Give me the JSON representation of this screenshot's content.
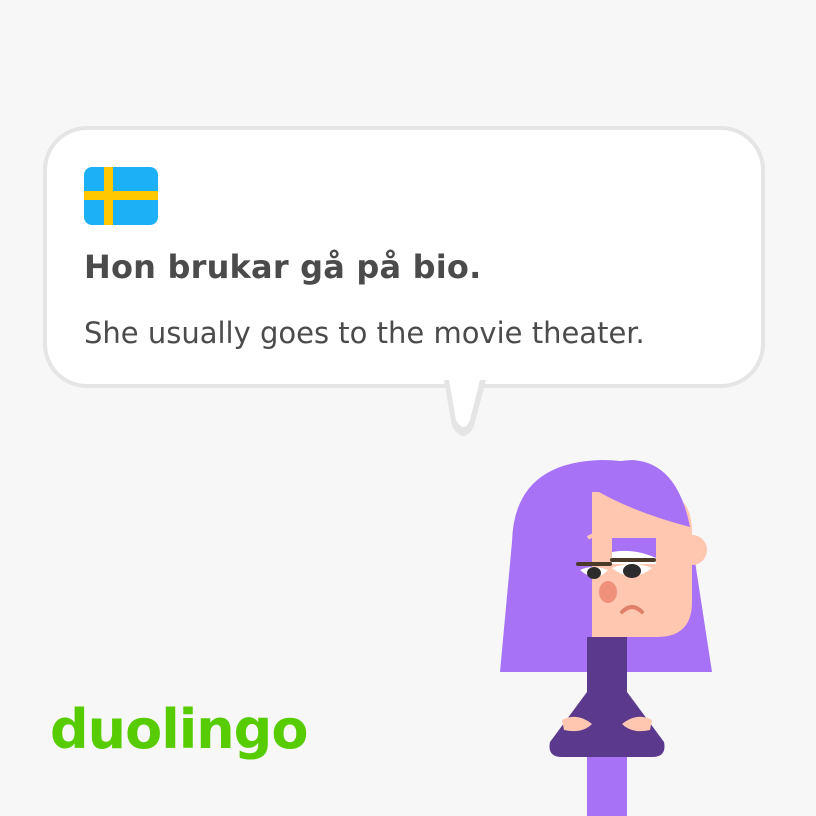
{
  "card": {
    "flag_icon": "sweden-flag-icon",
    "phrase": "Hon brukar gå på bio.",
    "translation": "She usually goes to the movie theater."
  },
  "brand": {
    "logo_text": "duolingo",
    "logo_color": "#58cc02"
  },
  "character": {
    "name_icon": "lily-character-illustration",
    "hair_color": "#a772f5",
    "skin_color": "#ffc6b0",
    "shirt_color": "#5b3a8e"
  },
  "colors": {
    "background": "#f7f7f8",
    "bubble_border": "#e5e5e5",
    "text": "#4b4b4b",
    "flag_blue": "#1cb0f6",
    "flag_yellow": "#ffc800"
  }
}
